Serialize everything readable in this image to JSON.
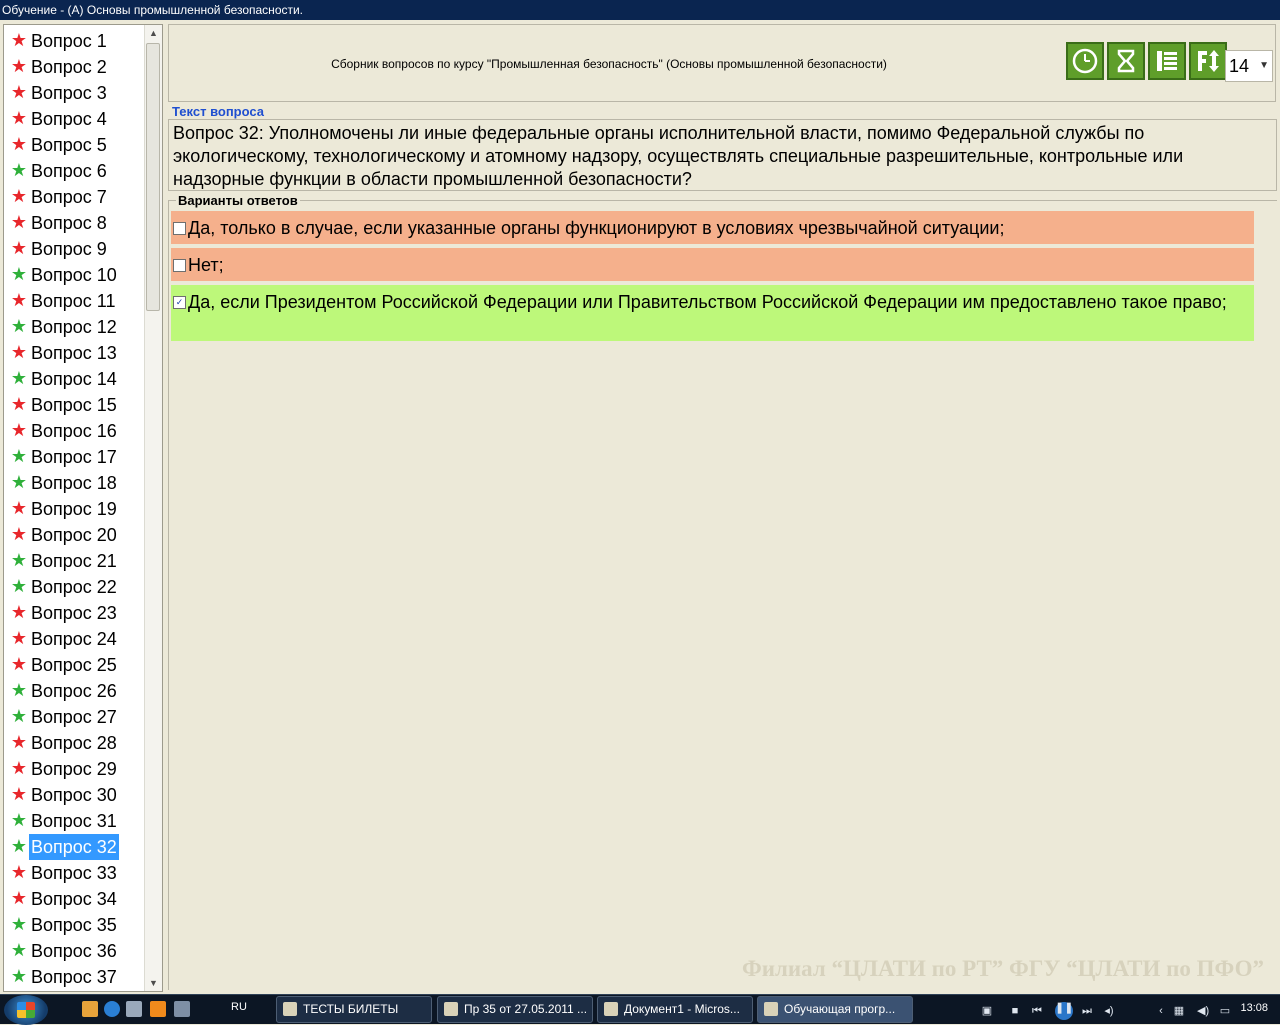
{
  "window": {
    "title": "Обучение - (А) Основы промышленной безопасности."
  },
  "colors": {
    "star_red": "#e8262b",
    "star_green": "#2fb03a",
    "answer_wrong": "#f5b08c",
    "answer_right": "#bdf87a",
    "selection": "#3399ff"
  },
  "questions": [
    {
      "label": "Вопрос 1",
      "status": "red"
    },
    {
      "label": "Вопрос 2",
      "status": "red"
    },
    {
      "label": "Вопрос 3",
      "status": "red"
    },
    {
      "label": "Вопрос 4",
      "status": "red"
    },
    {
      "label": "Вопрос 5",
      "status": "red"
    },
    {
      "label": "Вопрос 6",
      "status": "green"
    },
    {
      "label": "Вопрос 7",
      "status": "red"
    },
    {
      "label": "Вопрос 8",
      "status": "red"
    },
    {
      "label": "Вопрос 9",
      "status": "red"
    },
    {
      "label": "Вопрос 10",
      "status": "green"
    },
    {
      "label": "Вопрос 11",
      "status": "red"
    },
    {
      "label": "Вопрос 12",
      "status": "green"
    },
    {
      "label": "Вопрос 13",
      "status": "red"
    },
    {
      "label": "Вопрос 14",
      "status": "green"
    },
    {
      "label": "Вопрос 15",
      "status": "red"
    },
    {
      "label": "Вопрос 16",
      "status": "red"
    },
    {
      "label": "Вопрос 17",
      "status": "green"
    },
    {
      "label": "Вопрос 18",
      "status": "green"
    },
    {
      "label": "Вопрос 19",
      "status": "red"
    },
    {
      "label": "Вопрос 20",
      "status": "red"
    },
    {
      "label": "Вопрос 21",
      "status": "green"
    },
    {
      "label": "Вопрос 22",
      "status": "green"
    },
    {
      "label": "Вопрос 23",
      "status": "red"
    },
    {
      "label": "Вопрос 24",
      "status": "red"
    },
    {
      "label": "Вопрос 25",
      "status": "red"
    },
    {
      "label": "Вопрос 26",
      "status": "green"
    },
    {
      "label": "Вопрос 27",
      "status": "green"
    },
    {
      "label": "Вопрос 28",
      "status": "red"
    },
    {
      "label": "Вопрос 29",
      "status": "red"
    },
    {
      "label": "Вопрос 30",
      "status": "red"
    },
    {
      "label": "Вопрос 31",
      "status": "green"
    },
    {
      "label": "Вопрос 32",
      "status": "green",
      "selected": true
    },
    {
      "label": "Вопрос 33",
      "status": "red"
    },
    {
      "label": "Вопрос 34",
      "status": "red"
    },
    {
      "label": "Вопрос 35",
      "status": "green"
    },
    {
      "label": "Вопрос 36",
      "status": "green"
    },
    {
      "label": "Вопрос 37",
      "status": "green"
    }
  ],
  "header": {
    "subtitle": "Сборник вопросов по курсу \"Промышленная безопасность\" (Основы промышленной безопасности)",
    "tools": [
      {
        "name": "clock-icon"
      },
      {
        "name": "hourglass-icon"
      },
      {
        "name": "list-icon"
      },
      {
        "name": "font-size-icon"
      }
    ],
    "font_size": "14"
  },
  "question": {
    "section_label": "Текст вопроса",
    "text": "Вопрос 32: Уполномочены ли иные федеральные органы исполнительной власти, помимо Федеральной службы по экологическому, технологическому и атомному надзору, осуществлять специальные разрешительные, контрольные или надзорные функции в области промышленной безопасности?"
  },
  "answers": {
    "section_label": "Варианты ответов",
    "items": [
      {
        "text": "Да, только в случае, если указанные органы функционируют в условиях чрезвычайной ситуации;",
        "checked": false,
        "state": "wrong"
      },
      {
        "text": "Нет;",
        "checked": false,
        "state": "wrong"
      },
      {
        "text": "Да, если Президентом Российской Федерации или Правительством Российской Федерации им предоставлено такое право;",
        "checked": true,
        "state": "right"
      }
    ]
  },
  "watermark": "Филиал “ЦЛАТИ по РТ” ФГУ “ЦЛАТИ по ПФО”",
  "taskbar": {
    "language": "RU",
    "tasks": [
      {
        "label": "ТЕСТЫ БИЛЕТЫ",
        "active": false
      },
      {
        "label": "Пр 35 от 27.05.2011 ...",
        "active": false
      },
      {
        "label": "Документ1 - Micros...",
        "active": false
      },
      {
        "label": "Обучающая прогр...",
        "active": true
      }
    ],
    "clock": "13:08"
  }
}
